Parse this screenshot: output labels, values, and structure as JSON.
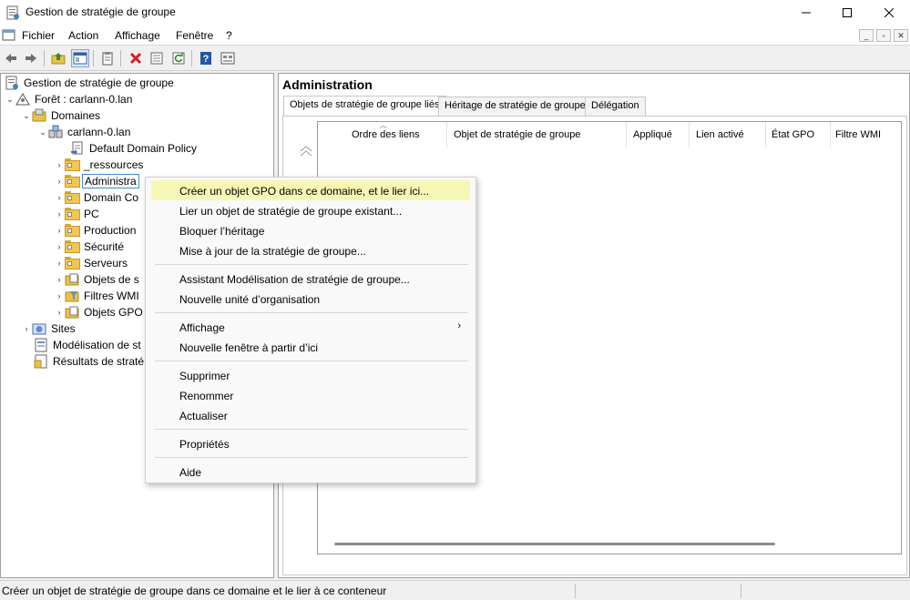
{
  "window": {
    "title": "Gestion de stratégie de groupe"
  },
  "menubar": {
    "items": [
      "Fichier",
      "Action",
      "Affichage",
      "Fenêtre",
      "?"
    ]
  },
  "toolbar": {
    "icons": [
      "back-arrow-icon",
      "forward-arrow-icon",
      "folder-up-icon",
      "show-hide-tree-icon",
      "clipboard-icon",
      "delete-x-icon",
      "properties-icon",
      "refresh-icon",
      "help-icon",
      "console-view-icon"
    ]
  },
  "tree": {
    "root": "Gestion de stratégie de groupe",
    "forest": "Forêt : carlann-0.lan",
    "domains": "Domaines",
    "domain": "carlann-0.lan",
    "children": [
      "Default Domain Policy",
      "_ressources",
      "Administra",
      "Domain Co",
      "PC",
      "Production",
      "Sécurité",
      "Serveurs",
      "Objets de s",
      "Filtres WMI",
      "Objets GPO"
    ],
    "sites": "Sites",
    "modeling": "Modélisation de st",
    "results": "Résultats de straté"
  },
  "content": {
    "title": "Administration",
    "tabs": [
      "Objets de stratégie de groupe liés",
      "Héritage de stratégie de groupe",
      "Délégation"
    ],
    "active_tab": 0,
    "columns": [
      "Ordre des liens",
      "Objet de stratégie de groupe",
      "Appliqué",
      "Lien activé",
      "État GPO",
      "Filtre WMI"
    ]
  },
  "context_menu": {
    "groups": [
      [
        "Créer un objet GPO dans ce domaine, et le lier ici...",
        "Lier un objet de stratégie de groupe existant...",
        "Bloquer l’héritage",
        "Mise à jour de la stratégie de groupe..."
      ],
      [
        "Assistant Modélisation de stratégie de groupe...",
        "Nouvelle unité d’organisation"
      ],
      [
        "Affichage",
        "Nouvelle fenêtre à partir d’ici"
      ],
      [
        "Supprimer",
        "Renommer",
        "Actualiser"
      ],
      [
        "Propriétés"
      ],
      [
        "Aide"
      ]
    ],
    "highlighted": "Créer un objet GPO dans ce domaine, et le lier ici...",
    "submenu_item": "Affichage",
    "highlight_color": "#f7f7b5"
  },
  "statusbar": {
    "text": "Créer un objet de stratégie de groupe dans ce domaine et le lier à ce conteneur"
  },
  "colors": {
    "selection_border": "#3b8ad8",
    "folder": "#f2c64f"
  }
}
